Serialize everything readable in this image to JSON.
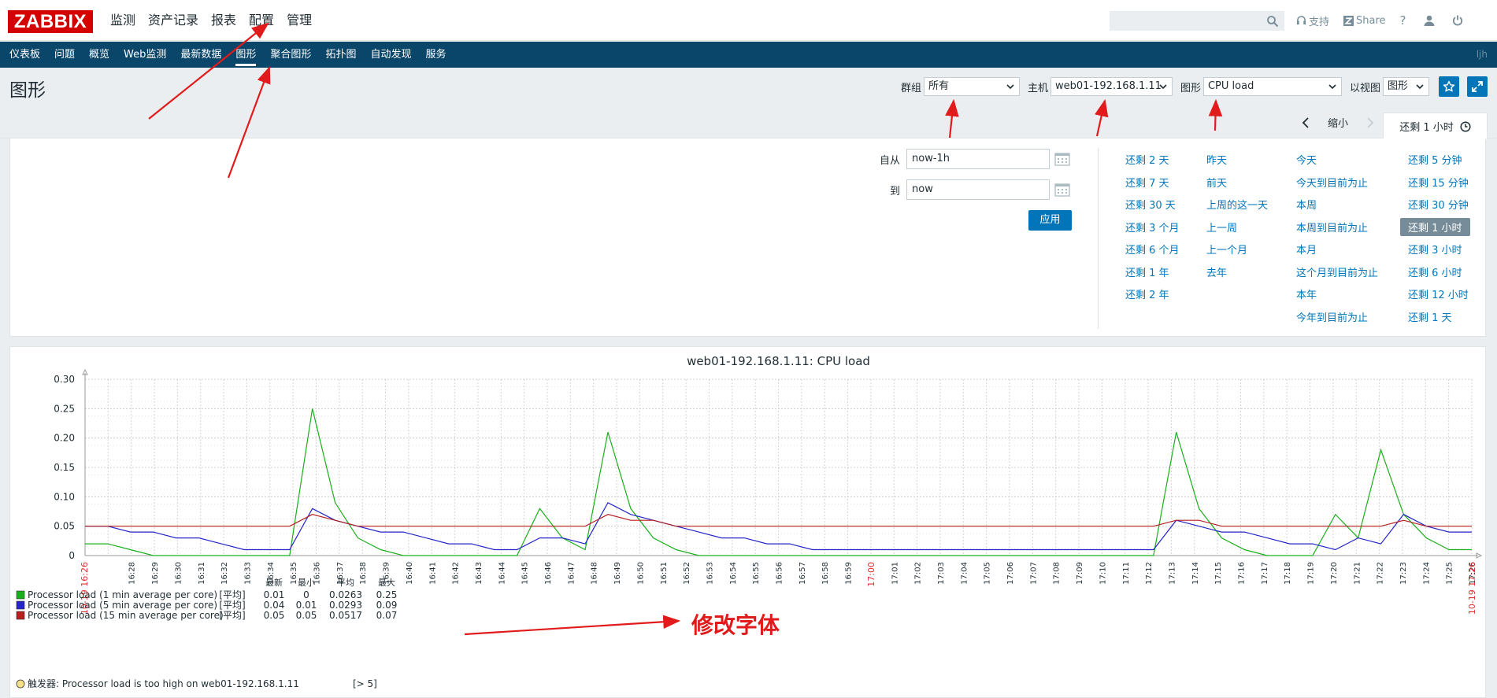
{
  "app": {
    "logo": "ZABBIX"
  },
  "main_menu": [
    {
      "label": "监测",
      "active": true
    },
    {
      "label": "资产记录"
    },
    {
      "label": "报表"
    },
    {
      "label": "配置"
    },
    {
      "label": "管理"
    }
  ],
  "top_links": {
    "support": "支持",
    "share": "Share",
    "help": "?"
  },
  "sub_menu": [
    {
      "label": "仪表板"
    },
    {
      "label": "问题"
    },
    {
      "label": "概览"
    },
    {
      "label": "Web监测"
    },
    {
      "label": "最新数据"
    },
    {
      "label": "图形",
      "active": true
    },
    {
      "label": "聚合图形"
    },
    {
      "label": "拓扑图"
    },
    {
      "label": "自动发现"
    },
    {
      "label": "服务"
    }
  ],
  "sub_user": "ljh",
  "page": {
    "title": "图形",
    "filters": {
      "group_label": "群组",
      "group_value": "所有",
      "host_label": "主机",
      "host_value": "web01-192.168.1.11",
      "graph_label": "图形",
      "graph_value": "CPU load",
      "view_label": "以视图",
      "view_value": "图形"
    }
  },
  "time_tabs": {
    "zoom_out": "缩小",
    "active_tab": "还剩 1 小时"
  },
  "time_filter": {
    "from_label": "自从",
    "from_value": "now-1h",
    "to_label": "到",
    "to_value": "now",
    "apply": "应用"
  },
  "quick_ranges": {
    "col1": [
      "还剩 2 天",
      "还剩 7 天",
      "还剩 30 天",
      "还剩 3 个月",
      "还剩 6 个月",
      "还剩 1 年",
      "还剩 2 年"
    ],
    "col2": [
      "昨天",
      "前天",
      "上周的这一天",
      "上一周",
      "上一个月",
      "去年"
    ],
    "col3": [
      "今天",
      "今天到目前为止",
      "本周",
      "本周到目前为止",
      "本月",
      "这个月到目前为止",
      "本年",
      "今年到目前为止"
    ],
    "col4": [
      "还剩 5 分钟",
      "还剩 15 分钟",
      "还剩 30 分钟",
      "还剩 1 小时",
      "还剩 3 小时",
      "还剩 6 小时",
      "还剩 12 小时",
      "还剩 1 天"
    ]
  },
  "chart_data": {
    "type": "line",
    "title": "web01-192.168.1.11: CPU load",
    "ylim": [
      0,
      0.3
    ],
    "y_ticks": [
      "0.30",
      "0.25",
      "0.20",
      "0.15",
      "0.10",
      "0.05",
      "0"
    ],
    "x_start_label": "10-19 16:26",
    "x_end_label": "10-19 17:26",
    "x_highlight_label": "17:00",
    "x_ticks": [
      "16:28",
      "16:29",
      "16:30",
      "16:31",
      "16:32",
      "16:33",
      "16:34",
      "16:35",
      "16:36",
      "16:37",
      "16:38",
      "16:39",
      "16:40",
      "16:41",
      "16:42",
      "16:43",
      "16:44",
      "16:45",
      "16:46",
      "16:47",
      "16:48",
      "16:49",
      "16:50",
      "16:51",
      "16:52",
      "16:53",
      "16:54",
      "16:55",
      "16:56",
      "16:57",
      "16:58",
      "16:59",
      "17:00",
      "17:01",
      "17:02",
      "17:03",
      "17:04",
      "17:05",
      "17:06",
      "17:07",
      "17:08",
      "17:09",
      "17:10",
      "17:11",
      "17:12",
      "17:13",
      "17:14",
      "17:15",
      "17:16",
      "17:17",
      "17:18",
      "17:19",
      "17:20",
      "17:21",
      "17:22",
      "17:23",
      "17:24",
      "17:25",
      "17:26"
    ],
    "x_minutes": [
      0,
      1,
      2,
      3,
      4,
      5,
      6,
      7,
      8,
      9,
      10,
      11,
      12,
      13,
      14,
      15,
      16,
      17,
      18,
      19,
      20,
      21,
      22,
      23,
      24,
      25,
      26,
      27,
      28,
      29,
      30,
      31,
      32,
      33,
      34,
      35,
      36,
      37,
      38,
      39,
      40,
      41,
      42,
      43,
      44,
      45,
      46,
      47,
      48,
      49,
      50,
      51,
      52,
      53,
      54,
      55,
      56,
      57,
      58,
      59,
      60
    ],
    "legend_header": [
      "最新",
      "最小",
      "平均",
      "最大"
    ],
    "series": [
      {
        "name": "Processor load (1 min average per core)",
        "color": "#1aaf1a",
        "func": "[平均]",
        "last": "0.01",
        "min": "0",
        "avg": "0.0263",
        "max": "0.25",
        "values": [
          0.02,
          0.02,
          0.01,
          0,
          0,
          0,
          0,
          0,
          0,
          0,
          0.25,
          0.09,
          0.03,
          0.01,
          0,
          0,
          0,
          0,
          0,
          0,
          0.08,
          0.03,
          0.01,
          0.21,
          0.08,
          0.03,
          0.01,
          0,
          0,
          0,
          0,
          0,
          0,
          0,
          0,
          0,
          0,
          0,
          0,
          0,
          0,
          0,
          0,
          0,
          0,
          0,
          0,
          0,
          0.21,
          0.08,
          0.03,
          0.01,
          0,
          0,
          0,
          0.07,
          0.03,
          0.18,
          0.07,
          0.03,
          0.01,
          0.01
        ]
      },
      {
        "name": "Processor load (5 min average per core)",
        "color": "#2424c8",
        "func": "[平均]",
        "last": "0.04",
        "min": "0.01",
        "avg": "0.0293",
        "max": "0.09",
        "values": [
          0.05,
          0.05,
          0.04,
          0.04,
          0.03,
          0.03,
          0.02,
          0.01,
          0.01,
          0.01,
          0.08,
          0.06,
          0.05,
          0.04,
          0.04,
          0.03,
          0.02,
          0.02,
          0.01,
          0.01,
          0.03,
          0.03,
          0.02,
          0.09,
          0.07,
          0.06,
          0.05,
          0.04,
          0.03,
          0.03,
          0.02,
          0.02,
          0.01,
          0.01,
          0.01,
          0.01,
          0.01,
          0.01,
          0.01,
          0.01,
          0.01,
          0.01,
          0.01,
          0.01,
          0.01,
          0.01,
          0.01,
          0.01,
          0.06,
          0.05,
          0.04,
          0.04,
          0.03,
          0.02,
          0.02,
          0.01,
          0.03,
          0.02,
          0.07,
          0.05,
          0.04,
          0.04
        ]
      },
      {
        "name": "Processor load (15 min average per core)",
        "color": "#b51f1f",
        "func": "[平均]",
        "last": "0.05",
        "min": "0.05",
        "avg": "0.0517",
        "max": "0.07",
        "values": [
          0.05,
          0.05,
          0.05,
          0.05,
          0.05,
          0.05,
          0.05,
          0.05,
          0.05,
          0.05,
          0.07,
          0.06,
          0.05,
          0.05,
          0.05,
          0.05,
          0.05,
          0.05,
          0.05,
          0.05,
          0.05,
          0.05,
          0.05,
          0.07,
          0.06,
          0.06,
          0.05,
          0.05,
          0.05,
          0.05,
          0.05,
          0.05,
          0.05,
          0.05,
          0.05,
          0.05,
          0.05,
          0.05,
          0.05,
          0.05,
          0.05,
          0.05,
          0.05,
          0.05,
          0.05,
          0.05,
          0.05,
          0.05,
          0.06,
          0.06,
          0.05,
          0.05,
          0.05,
          0.05,
          0.05,
          0.05,
          0.05,
          0.05,
          0.06,
          0.05,
          0.05,
          0.05
        ]
      }
    ],
    "trigger": {
      "label": "触发器: Processor load is too high on web01-192.168.1.11",
      "threshold": "[> 5]",
      "color": "#f6e08a"
    }
  },
  "annotation": {
    "text": "修改字体",
    "color": "#e11b1b"
  }
}
